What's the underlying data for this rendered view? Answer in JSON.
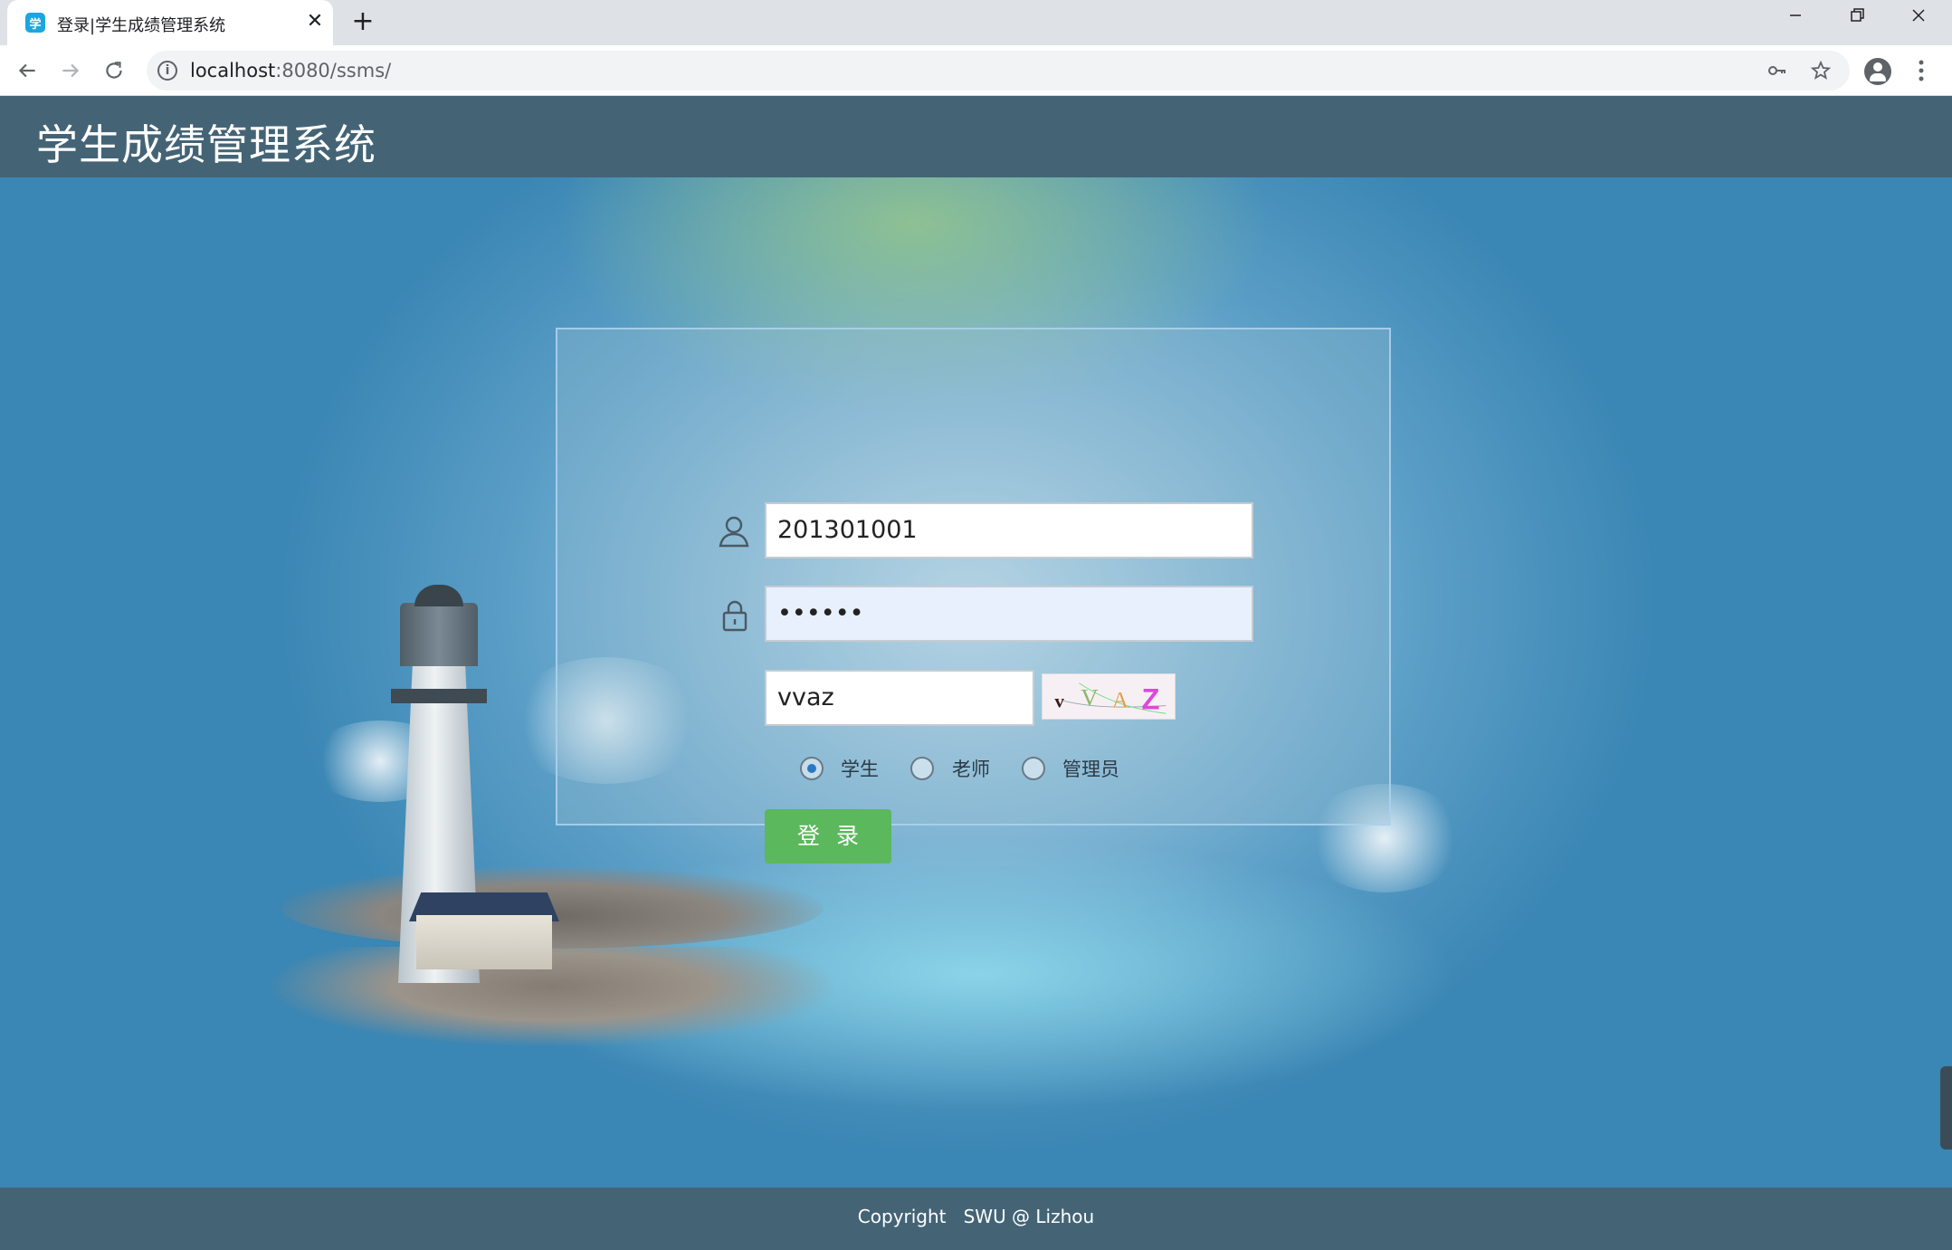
{
  "browser": {
    "tab_title": "登录|学生成绩管理系统",
    "tab_favicon_glyph": "学",
    "close_glyph": "✕",
    "new_tab_glyph": "+",
    "url_host": "localhost",
    "url_rest": ":8080/ssms/",
    "icons": {
      "back": "arrow-left-icon",
      "forward": "arrow-right-icon",
      "reload": "reload-icon",
      "info": "info-icon",
      "key": "key-icon",
      "star": "star-icon",
      "profile": "profile-icon",
      "menu": "more-vert-icon"
    }
  },
  "header": {
    "title": "学生成绩管理系统"
  },
  "login": {
    "username": "201301001",
    "password_masked": "••••••",
    "captcha_value": "vvaz",
    "captcha_image_text": "vVAZ",
    "roles": [
      {
        "label": "学生",
        "checked": true
      },
      {
        "label": "老师",
        "checked": false
      },
      {
        "label": "管理员",
        "checked": false
      }
    ],
    "submit_label": "登录"
  },
  "footer": {
    "text": "Copyright   SWU @ Lizhou"
  },
  "colors": {
    "header_bg": "#446476",
    "page_bg": "#3a86b4",
    "login_button": "#5cb85c",
    "autofill_bg": "#e8f0fe"
  }
}
